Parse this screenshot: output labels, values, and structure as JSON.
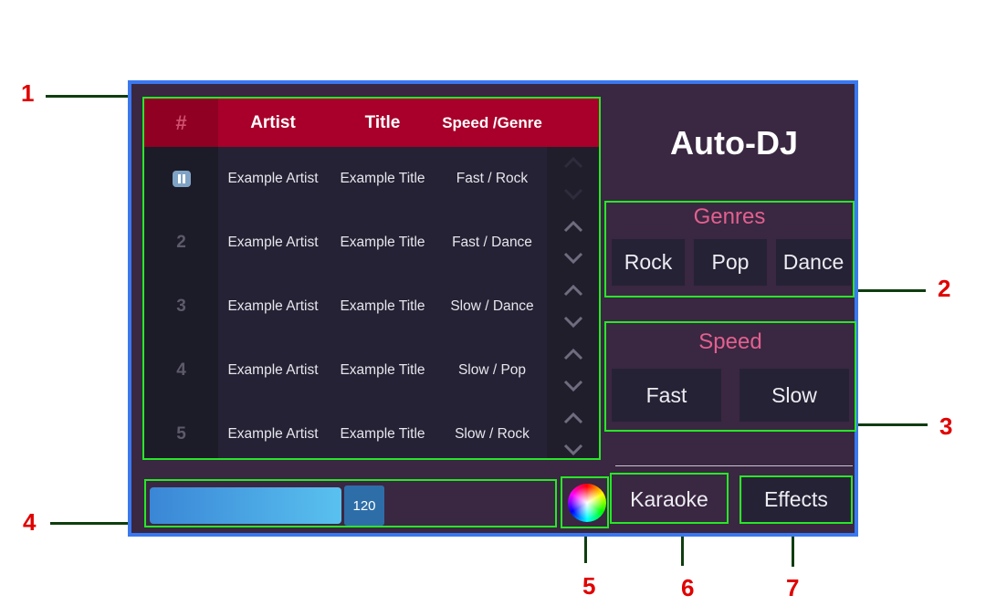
{
  "app": {
    "title": "Auto-DJ"
  },
  "table": {
    "headers": {
      "num": "#",
      "artist": "Artist",
      "title": "Title",
      "speed_genre": "Speed / Genre"
    },
    "rows": [
      {
        "num": "",
        "artist": "Example Artist",
        "title": "Example Title",
        "genre": "Fast / Rock",
        "playing": true
      },
      {
        "num": "2",
        "artist": "Example Artist",
        "title": "Example Title",
        "genre": "Fast / Dance",
        "playing": false
      },
      {
        "num": "3",
        "artist": "Example Artist",
        "title": "Example Title",
        "genre": "Slow / Dance",
        "playing": false
      },
      {
        "num": "4",
        "artist": "Example Artist",
        "title": "Example Title",
        "genre": "Slow / Pop",
        "playing": false
      },
      {
        "num": "5",
        "artist": "Example Artist",
        "title": "Example Title",
        "genre": "Slow / Rock",
        "playing": false
      }
    ]
  },
  "genres": {
    "title": "Genres",
    "buttons": [
      "Rock",
      "Pop",
      "Dance"
    ]
  },
  "speed": {
    "title": "Speed",
    "buttons": [
      "Fast",
      "Slow"
    ]
  },
  "tempo_slider": {
    "value": "120",
    "fill_fraction": 0.5
  },
  "buttons": {
    "karaoke": "Karaoke",
    "effects": "Effects"
  },
  "callouts": [
    "1",
    "2",
    "3",
    "4",
    "5",
    "6",
    "7"
  ],
  "colors": {
    "panel_bg": "#3a2741",
    "panel_border": "#3a78f0",
    "header_red": "#a8002a",
    "highlight_green": "#27e727",
    "callout_red": "#e00000",
    "section_title_pink": "#e2608f"
  },
  "icons": {
    "playing": "pause-icon",
    "move_up": "chevron-up-icon",
    "move_down": "chevron-down-icon",
    "color": "color-wheel-icon"
  }
}
